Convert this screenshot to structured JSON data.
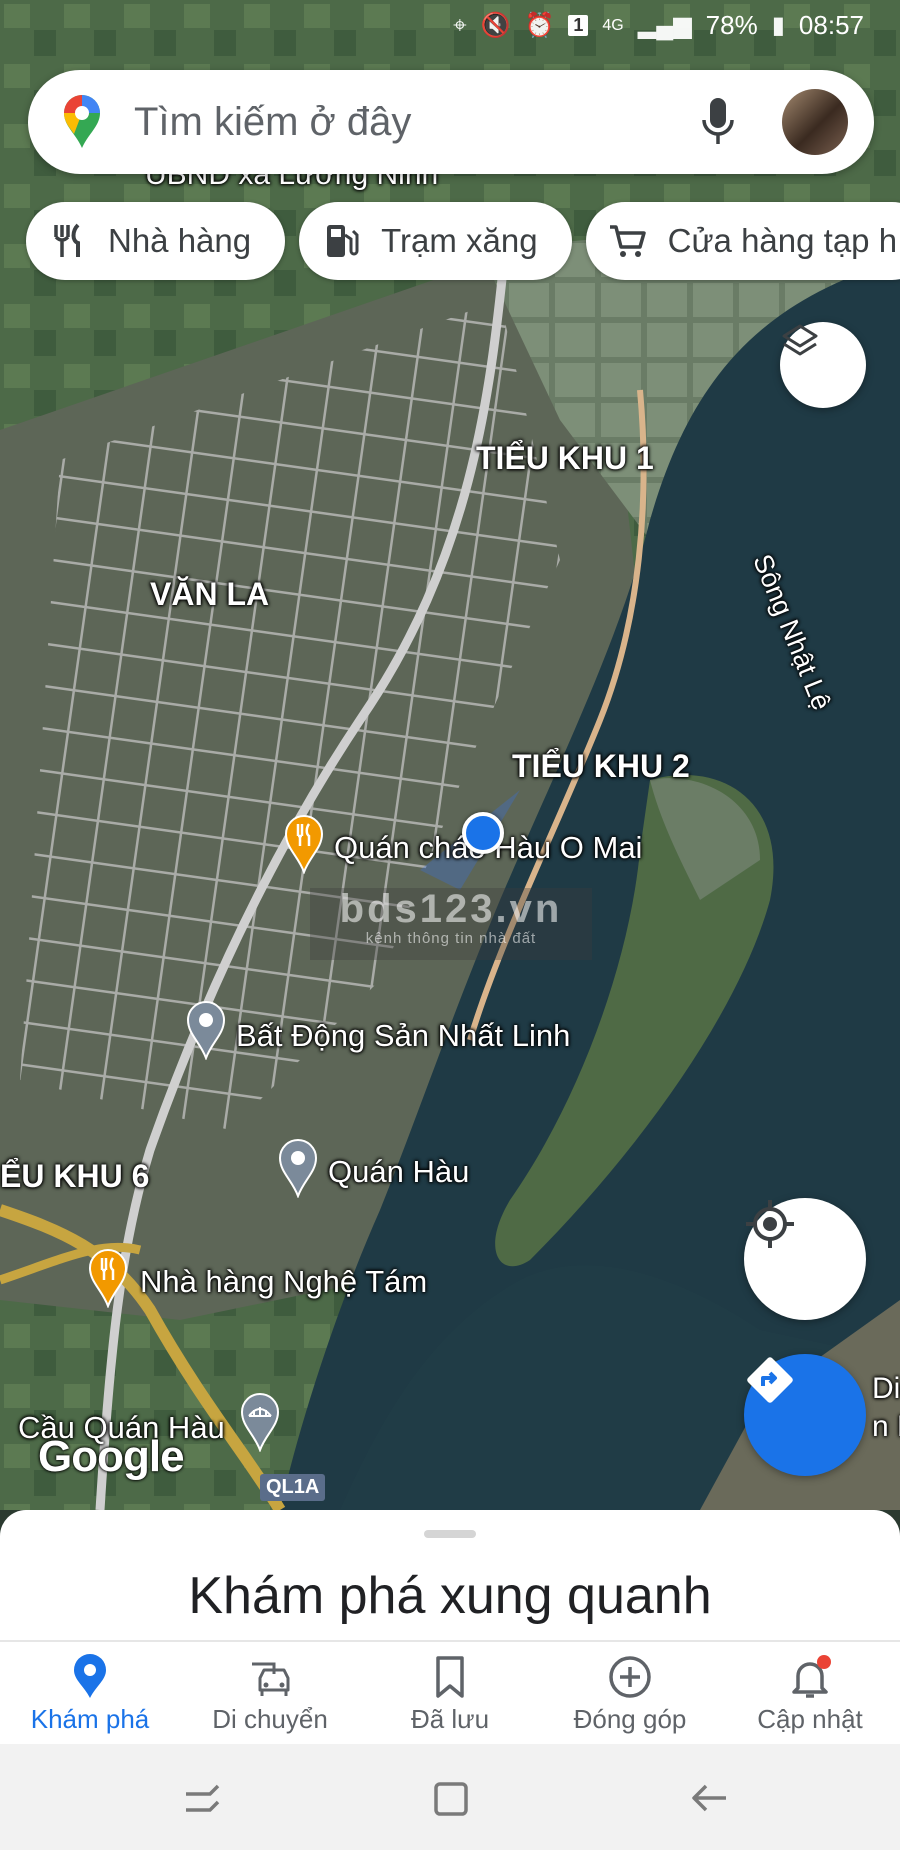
{
  "status_bar": {
    "battery": "78%",
    "time": "08:57",
    "network": "4G",
    "sim_badge": "1"
  },
  "search": {
    "placeholder": "Tìm kiếm ở đây"
  },
  "chips": [
    {
      "label": "Nhà hàng",
      "icon": "fork-knife-icon"
    },
    {
      "label": "Trạm xăng",
      "icon": "gas-station-icon"
    },
    {
      "label": "Cửa hàng tạp h",
      "icon": "cart-icon"
    }
  ],
  "map": {
    "top_label": "UBND xã Lương Ninh",
    "areas": [
      "TIỂU KHU 1",
      "VĂN LA",
      "TIỂU KHU 2",
      "ỂU KHU 6"
    ],
    "river": "Sông Nhật Lệ",
    "pois": [
      "Quán cháo Hàu O Mai",
      "Bất Động Sản Nhất Linh",
      "Quán Hàu",
      "Nhà hàng Nghệ Tám",
      "Cầu Quán Hàu"
    ],
    "edge_right": [
      "Diện",
      "n N"
    ],
    "google": "Google",
    "road_shield": "QL1A",
    "watermark_big": "bds123.vn",
    "watermark_small": "kênh thông tin nhà đất"
  },
  "sheet": {
    "title": "Khám phá xung quanh"
  },
  "nav": [
    {
      "label": "Khám phá",
      "icon": "location-pin-icon",
      "active": true
    },
    {
      "label": "Di chuyển",
      "icon": "car-icon",
      "active": false
    },
    {
      "label": "Đã lưu",
      "icon": "bookmark-icon",
      "active": false
    },
    {
      "label": "Đóng góp",
      "icon": "plus-circle-icon",
      "active": false
    },
    {
      "label": "Cập nhật",
      "icon": "bell-icon",
      "active": false
    }
  ],
  "colors": {
    "accent": "#1a73e8",
    "water": "#1f3a45",
    "land": "#4a5a3e"
  }
}
